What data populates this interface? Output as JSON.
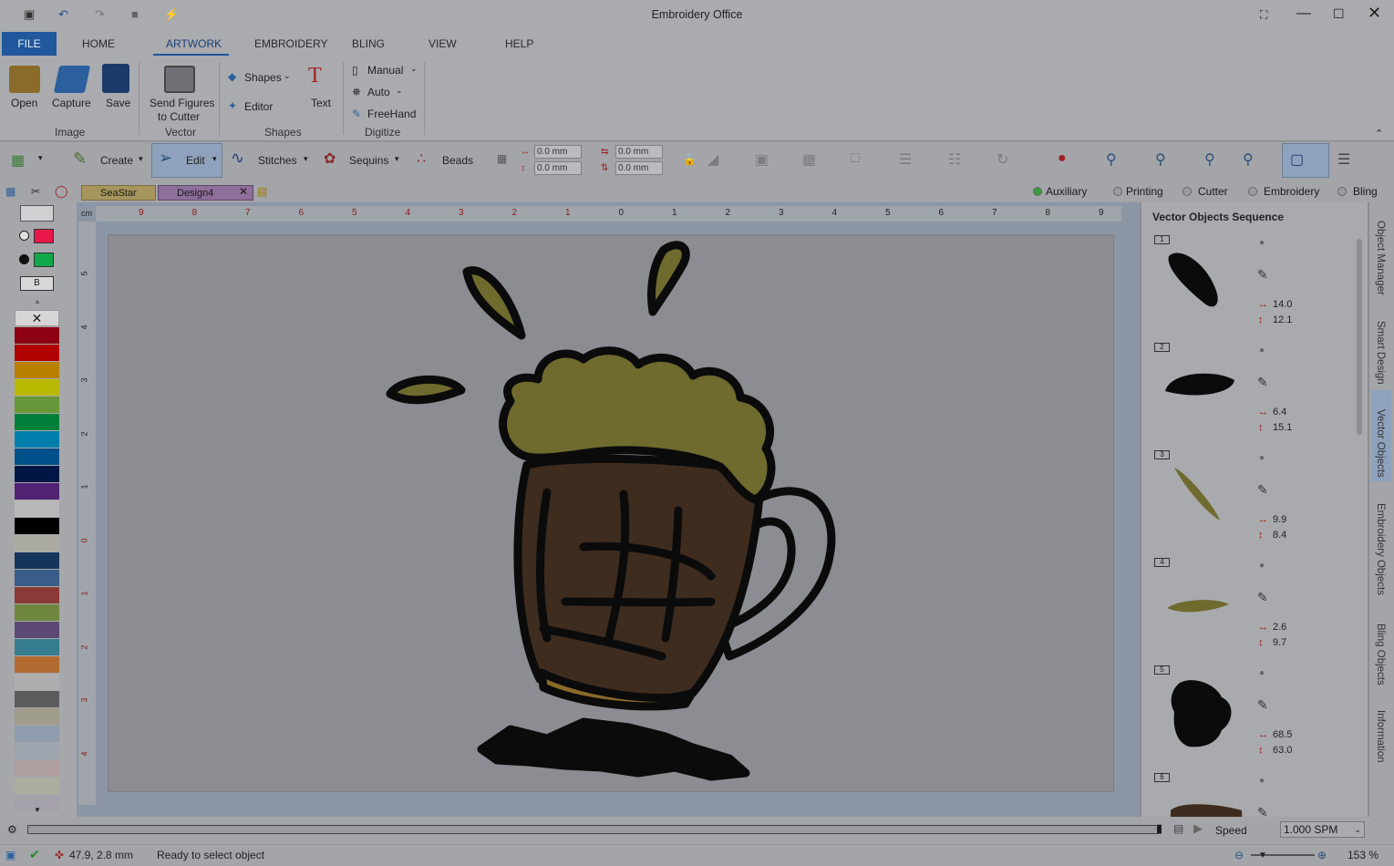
{
  "app": {
    "title": "Embroidery Office"
  },
  "menu_tabs": [
    {
      "label": "FILE"
    },
    {
      "label": "HOME"
    },
    {
      "label": "ARTWORK"
    },
    {
      "label": "EMBROIDERY"
    },
    {
      "label": "BLING"
    },
    {
      "label": "VIEW"
    },
    {
      "label": "HELP"
    }
  ],
  "ribbon": {
    "open": "Open",
    "capture": "Capture",
    "save": "Save",
    "group_image": "Image",
    "send_figures_1": "Send Figures",
    "send_figures_2": "to Cutter",
    "group_vector": "Vector",
    "shapes": "Shapes",
    "editor": "Editor",
    "text": "Text",
    "group_shapes": "Shapes",
    "manual": "Manual",
    "auto": "Auto",
    "freehand": "FreeHand",
    "group_digitize": "Digitize"
  },
  "toolbar": {
    "create": "Create",
    "edit": "Edit",
    "stitches": "Stitches",
    "sequins": "Sequins",
    "beads": "Beads",
    "w1": "0.0 mm",
    "w2": "0.0 mm",
    "h1": "0.0 mm",
    "h2": "0.0 mm"
  },
  "doc_tabs": [
    {
      "label": "SeaStar"
    },
    {
      "label": "Design4"
    }
  ],
  "filters": {
    "auxiliary": "Auxiliary",
    "printing": "Printing",
    "cutter": "Cutter",
    "embroidery": "Embroidery",
    "bling": "Bling"
  },
  "ruler": {
    "unit": "cm",
    "top_ticks": [
      "9",
      "8",
      "7",
      "6",
      "5",
      "4",
      "3",
      "2",
      "1",
      "0",
      "1",
      "2",
      "3",
      "4",
      "5",
      "6",
      "7",
      "8",
      "9"
    ],
    "left_ticks": [
      "5",
      "4",
      "3",
      "2",
      "1",
      "0",
      "1",
      "2",
      "3",
      "4"
    ]
  },
  "palette": {
    "outline_color": "#e8174a",
    "fill_color": "#0fa84a",
    "text_box": "B",
    "colors": [
      "#c4001a",
      "#f50000",
      "#ffb000",
      "#ffff00",
      "#8fd14f",
      "#00b050",
      "#00b0f0",
      "#0070c0",
      "#002060",
      "#7030a0",
      "#ffffff",
      "#000000",
      "#eeece1",
      "#1f497d",
      "#4f81bd",
      "#c0504d",
      "#9bbb59",
      "#8064a2",
      "#4bacc6",
      "#f79646",
      "#f2f2f2",
      "#7f7f7f",
      "#ddd9c3",
      "#c6d9f0",
      "#dbe5f1",
      "#f2dcdb",
      "#ebf1dd",
      "#e5e0ec"
    ]
  },
  "right_panel": {
    "title": "Vector Objects Sequence",
    "objects": [
      {
        "num": "1",
        "w": "14.0",
        "h": "12.1"
      },
      {
        "num": "2",
        "w": "6.4",
        "h": "15.1"
      },
      {
        "num": "3",
        "w": "9.9",
        "h": "8.4"
      },
      {
        "num": "4",
        "w": "2.6",
        "h": "9.7"
      },
      {
        "num": "5",
        "w": "68.5",
        "h": "63.0"
      },
      {
        "num": "6",
        "w": "",
        "h": ""
      }
    ]
  },
  "side_tabs": [
    "Object Manager",
    "Smart Design",
    "Vector Objects",
    "Embroidery Objects",
    "Bling Objects",
    "Information"
  ],
  "bottom": {
    "speed_label": "Speed",
    "speed_value": "1.000 SPM"
  },
  "status": {
    "coords": "47.9, 2.8 mm",
    "message": "Ready to select object",
    "zoom": "153 %"
  },
  "colors": {
    "accent": "#21579c",
    "foam": "#6f6a2e",
    "mug": "#3e2c1f"
  }
}
